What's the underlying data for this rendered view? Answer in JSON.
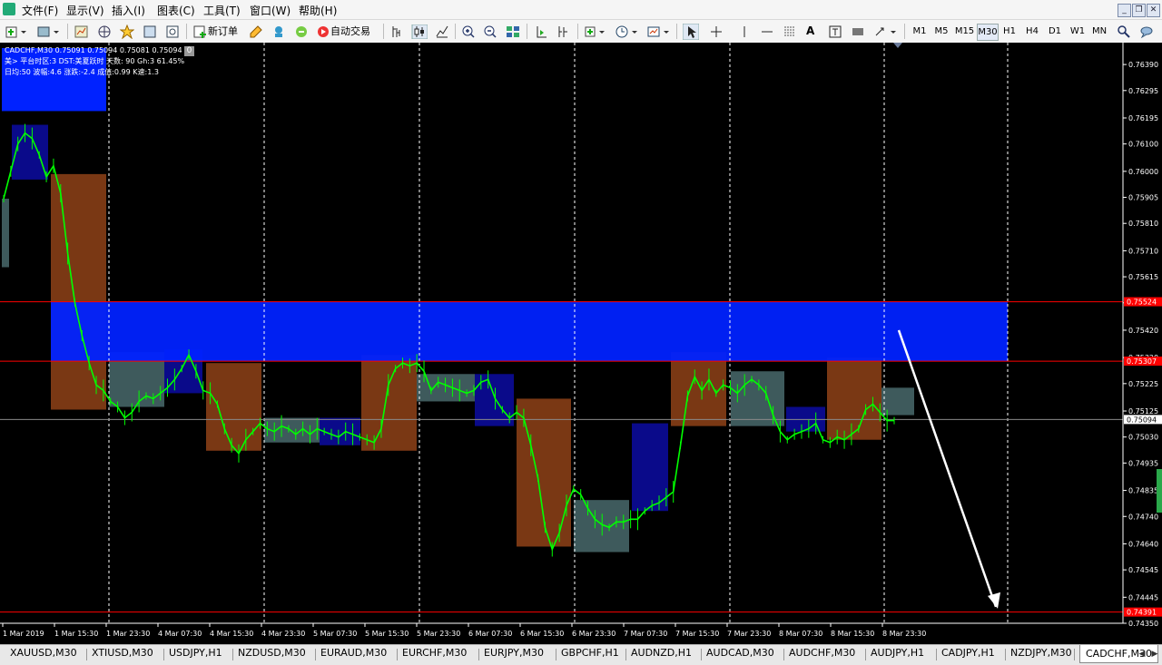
{
  "menu": [
    "文件(F)",
    "显示(V)",
    "插入(I)",
    "图表(C)",
    "工具(T)",
    "窗口(W)",
    "帮助(H)"
  ],
  "toolbar": {
    "new_order": "新订单",
    "auto_trade": "自动交易",
    "timeframes": [
      "M1",
      "M5",
      "M15",
      "M30",
      "H1",
      "H4",
      "D1",
      "W1",
      "MN"
    ],
    "active_timeframe": "M30"
  },
  "chart": {
    "info_line1": "CADCHF,M30  0.75091 0.75094 0.75081 0.75094",
    "info_line2": "美> 平台时区:3  DST:美夏跃时 天数: 90  Gh:3  61.45%",
    "info_line3": "日均:50  波幅:4.6  涨跌:-2.4  成值:0.99  K速:1.3",
    "info_zero": "0"
  },
  "chart_data": {
    "type": "line",
    "symbol": "CADCHF,M30",
    "ylim": [
      0.7435,
      0.7645
    ],
    "y_ticks": [
      "0.76390",
      "0.76295",
      "0.76195",
      "0.76100",
      "0.76000",
      "0.75905",
      "0.75810",
      "0.75710",
      "0.75615",
      "0.75520",
      "0.75420",
      "0.75320",
      "0.75225",
      "0.75125",
      "0.75030",
      "0.74935",
      "0.74835",
      "0.74740",
      "0.74640",
      "0.74545",
      "0.74445",
      "0.74350"
    ],
    "x_ticks": [
      "1 Mar 2019",
      "1 Mar 15:30",
      "1 Mar 23:30",
      "4 Mar 07:30",
      "4 Mar 15:30",
      "4 Mar 23:30",
      "5 Mar 07:30",
      "5 Mar 15:30",
      "5 Mar 23:30",
      "6 Mar 07:30",
      "6 Mar 15:30",
      "6 Mar 23:30",
      "7 Mar 07:30",
      "7 Mar 15:30",
      "7 Mar 23:30",
      "8 Mar 07:30",
      "8 Mar 15:30",
      "8 Mar 23:30"
    ],
    "current_price": "0.75094",
    "level_labels": [
      "0.75524",
      "0.75307",
      "0.74391"
    ],
    "price_series": [
      0.759,
      0.76,
      0.761,
      0.7614,
      0.7612,
      0.7606,
      0.7598,
      0.7602,
      0.7592,
      0.757,
      0.7552,
      0.754,
      0.753,
      0.7522,
      0.752,
      0.7516,
      0.7514,
      0.751,
      0.7512,
      0.7516,
      0.7518,
      0.7517,
      0.7519,
      0.7521,
      0.7524,
      0.7528,
      0.7533,
      0.7527,
      0.752,
      0.7519,
      0.7515,
      0.7506,
      0.75,
      0.7497,
      0.7502,
      0.7505,
      0.7508,
      0.7506,
      0.7505,
      0.7507,
      0.7506,
      0.7504,
      0.7506,
      0.7504,
      0.7506,
      0.7505,
      0.7504,
      0.7503,
      0.7505,
      0.7504,
      0.7503,
      0.7502,
      0.7501,
      0.7506,
      0.7522,
      0.7528,
      0.753,
      0.7529,
      0.753,
      0.7527,
      0.752,
      0.7523,
      0.7522,
      0.7521,
      0.752,
      0.7519,
      0.752,
      0.7523,
      0.7524,
      0.7517,
      0.7513,
      0.751,
      0.7512,
      0.751,
      0.75,
      0.7488,
      0.747,
      0.7462,
      0.7468,
      0.7478,
      0.7484,
      0.7482,
      0.7477,
      0.7473,
      0.7471,
      0.747,
      0.7472,
      0.7472,
      0.7473,
      0.7473,
      0.7476,
      0.7478,
      0.7479,
      0.7481,
      0.7483,
      0.75,
      0.7518,
      0.7525,
      0.752,
      0.7524,
      0.7519,
      0.7522,
      0.7521,
      0.7519,
      0.7522,
      0.7524,
      0.7522,
      0.7519,
      0.7511,
      0.7505,
      0.7502,
      0.7504,
      0.7505,
      0.7506,
      0.7508,
      0.7502,
      0.7501,
      0.7503,
      0.7502,
      0.7504,
      0.7506,
      0.7513,
      0.7515,
      0.7512,
      0.7509,
      0.7509
    ],
    "zones": [
      {
        "type": "blue",
        "x0": "1 Mar 2019",
        "y_low": 0.7622,
        "y_high": 0.7645,
        "color": "#0022ff"
      },
      {
        "type": "navy",
        "y_low": 0.7597,
        "y_high": 0.7617,
        "color": "#0a0a8a"
      },
      {
        "type": "gray",
        "y_low": 0.7565,
        "y_high": 0.759,
        "color": "#3e5a5c"
      },
      {
        "type": "brown",
        "y_low": 0.7513,
        "y_high": 0.7599,
        "color": "#7a3814"
      },
      {
        "type": "gray",
        "y_low": 0.7514,
        "y_high": 0.7534,
        "color": "#3e5a5c"
      },
      {
        "type": "navy",
        "y_low": 0.7519,
        "y_high": 0.7535,
        "color": "#0a0a8a"
      },
      {
        "type": "brown",
        "y_low": 0.7498,
        "y_high": 0.753,
        "color": "#7a3814"
      },
      {
        "type": "gray",
        "y_low": 0.7501,
        "y_high": 0.751,
        "color": "#3e5a5c"
      },
      {
        "type": "navy",
        "y_low": 0.75,
        "y_high": 0.751,
        "color": "#0a0a8a"
      },
      {
        "type": "brown",
        "y_low": 0.7498,
        "y_high": 0.7533,
        "color": "#7a3814"
      },
      {
        "type": "gray",
        "y_low": 0.7516,
        "y_high": 0.7526,
        "color": "#3e5a5c"
      },
      {
        "type": "navy",
        "y_low": 0.7507,
        "y_high": 0.7526,
        "color": "#0a0a8a"
      },
      {
        "type": "brown",
        "y_low": 0.7463,
        "y_high": 0.7517,
        "color": "#7a3814"
      },
      {
        "type": "gray",
        "y_low": 0.7461,
        "y_high": 0.748,
        "color": "#3e5a5c"
      },
      {
        "type": "navy",
        "y_low": 0.7476,
        "y_high": 0.7508,
        "color": "#0a0a8a"
      },
      {
        "type": "brown",
        "y_low": 0.7507,
        "y_high": 0.7534,
        "color": "#7a3814"
      },
      {
        "type": "gray",
        "y_low": 0.7507,
        "y_high": 0.7527,
        "color": "#3e5a5c"
      },
      {
        "type": "navy",
        "y_low": 0.7505,
        "y_high": 0.7514,
        "color": "#0a0a8a"
      },
      {
        "type": "brown",
        "y_low": 0.7502,
        "y_high": 0.7532,
        "color": "#7a3814"
      },
      {
        "type": "gray",
        "y_low": 0.7511,
        "y_high": 0.7521,
        "color": "#3e5a5c"
      }
    ],
    "big_zone": {
      "y_low": 0.75307,
      "y_high": 0.75524,
      "color": "#0022ff"
    },
    "projection_arrow": {
      "from_price": 0.7542,
      "to_price": 0.7441
    },
    "grid": true
  },
  "tabs": [
    "XAUUSD,M30",
    "XTIUSD,M30",
    "USDJPY,H1",
    "NZDUSD,M30",
    "EURAUD,M30",
    "EURCHF,M30",
    "EURJPY,M30",
    "GBPCHF,H1",
    "AUDNZD,H1",
    "AUDCAD,M30",
    "AUDCHF,M30",
    "AUDJPY,H1",
    "CADJPY,H1",
    "NZDJPY,M30",
    "CADCHF,M30"
  ],
  "active_tab": "CADCHF,M30",
  "colors": {
    "bull": "#00ff00",
    "axis": "#ffffff",
    "red_line": "#ff0000"
  }
}
